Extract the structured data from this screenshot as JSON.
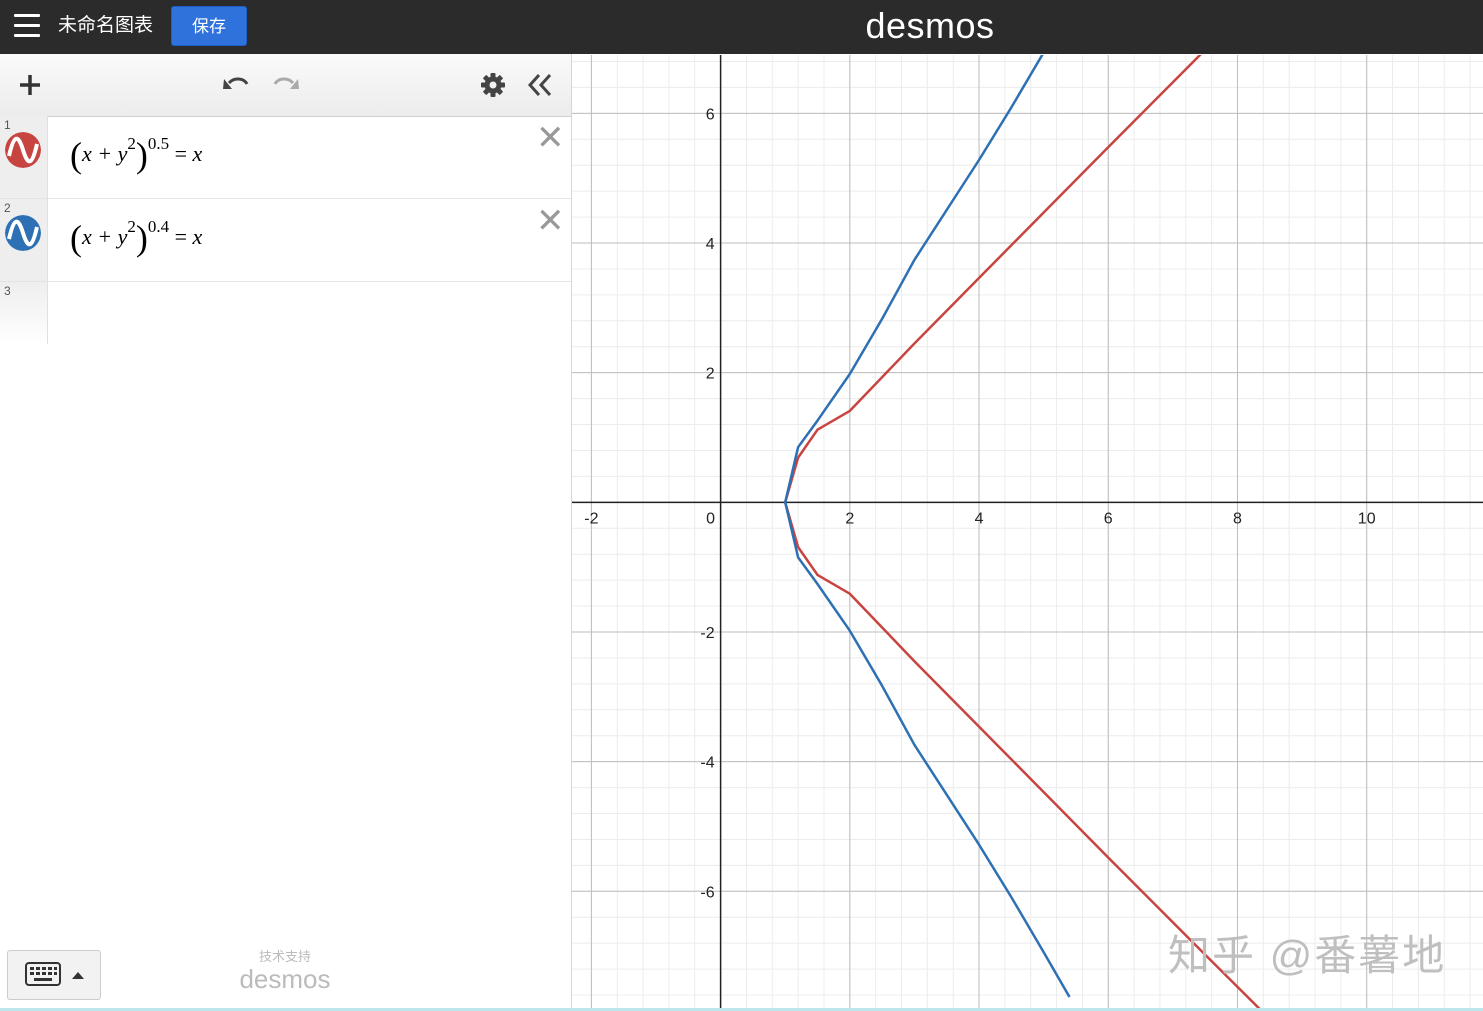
{
  "header": {
    "title": "未命名图表",
    "save_label": "保存",
    "brand": "desmos"
  },
  "toolbar": {
    "add_icon": "plus-icon",
    "undo_icon": "undo-icon",
    "redo_icon": "redo-icon",
    "settings_icon": "gear-icon",
    "collapse_icon": "double-chevron-left-icon"
  },
  "expressions": [
    {
      "number": "1",
      "color": "#c74440",
      "base": "x + y",
      "inner_exp": "2",
      "outer_exp": "0.5",
      "rhs": "x"
    },
    {
      "number": "2",
      "color": "#2d70b3",
      "base": "x + y",
      "inner_exp": "2",
      "outer_exp": "0.4",
      "rhs": "x"
    },
    {
      "number": "3"
    }
  ],
  "footer": {
    "powered_small": "技术支持",
    "powered_logo": "desmos",
    "keypad_icon": "keyboard-icon"
  },
  "watermark": "知乎 @番薯地",
  "chart_data": {
    "type": "line",
    "x_range": [
      -2.3,
      11.8
    ],
    "y_range": [
      -7.8,
      6.9
    ],
    "x_ticks": [
      -2,
      0,
      2,
      4,
      6,
      8,
      10
    ],
    "y_ticks": [
      -6,
      -4,
      -2,
      2,
      4,
      6
    ],
    "grid": true,
    "series": [
      {
        "expr": "(x+y^2)^0.5=x",
        "color": "#c74440",
        "x": [
          1.0,
          1.2,
          1.5,
          2.0,
          3.0,
          4.0,
          5.0,
          6.0,
          7.0,
          7.5,
          8.5
        ],
        "y": [
          0.0,
          0.69,
          1.12,
          1.41,
          2.45,
          3.46,
          4.47,
          5.48,
          6.48,
          6.98,
          7.97
        ]
      },
      {
        "expr": "(x+y^2)^0.4=x",
        "color": "#2d70b3",
        "x": [
          1.0,
          1.2,
          1.5,
          2.0,
          2.5,
          3.0,
          4.0,
          4.5,
          5.0,
          5.4
        ],
        "y": [
          0.0,
          0.85,
          1.26,
          1.98,
          2.83,
          3.74,
          5.28,
          6.09,
          6.94,
          7.63
        ]
      }
    ]
  }
}
